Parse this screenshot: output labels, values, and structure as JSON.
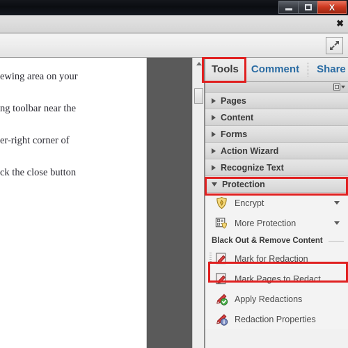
{
  "window": {
    "controls": [
      {
        "name": "minimize",
        "label": "–"
      },
      {
        "name": "maximize",
        "label": "□"
      },
      {
        "name": "close",
        "label": "X"
      }
    ]
  },
  "menustrip": {
    "close_label": "✖"
  },
  "toolstrip": {
    "fit_icon": "fit-page-icon"
  },
  "document": {
    "lines": [
      "ewing area on your",
      "ng toolbar near the",
      "er-right corner of",
      "ck the close button"
    ]
  },
  "tabs": [
    {
      "label": "Tools",
      "active": true
    },
    {
      "label": "Comment",
      "active": false
    },
    {
      "label": "Share",
      "active": false
    }
  ],
  "panel": {
    "options_icon": "panel-options-icon",
    "sections": [
      {
        "label": "Pages",
        "expanded": false
      },
      {
        "label": "Content",
        "expanded": false
      },
      {
        "label": "Forms",
        "expanded": false
      },
      {
        "label": "Action Wizard",
        "expanded": false
      },
      {
        "label": "Recognize Text",
        "expanded": false
      },
      {
        "label": "Protection",
        "expanded": true
      }
    ],
    "protection": {
      "tools": [
        {
          "label": "Encrypt",
          "icon": "shield-icon",
          "has_dropdown": true
        },
        {
          "label": "More Protection",
          "icon": "form-shield-icon",
          "has_dropdown": true
        }
      ],
      "group_title": "Black Out & Remove Content",
      "redaction_tools": [
        {
          "label": "Mark for Redaction",
          "icon": "page-pen-icon",
          "selected": true
        },
        {
          "label": "Mark Pages to Redact",
          "icon": "pages-pen-icon",
          "selected": false
        },
        {
          "label": "Apply Redactions",
          "icon": "marker-check-icon",
          "selected": false
        },
        {
          "label": "Redaction Properties",
          "icon": "marker-info-icon",
          "selected": false
        }
      ]
    }
  },
  "highlights": [
    {
      "name": "tools-tab-highlight",
      "color": "#e02020"
    },
    {
      "name": "protection-section-highlight",
      "color": "#e02020"
    },
    {
      "name": "mark-for-redaction-highlight",
      "color": "#e02020"
    }
  ],
  "scrollbar": {
    "up_arrow": "scroll-up-arrow"
  }
}
